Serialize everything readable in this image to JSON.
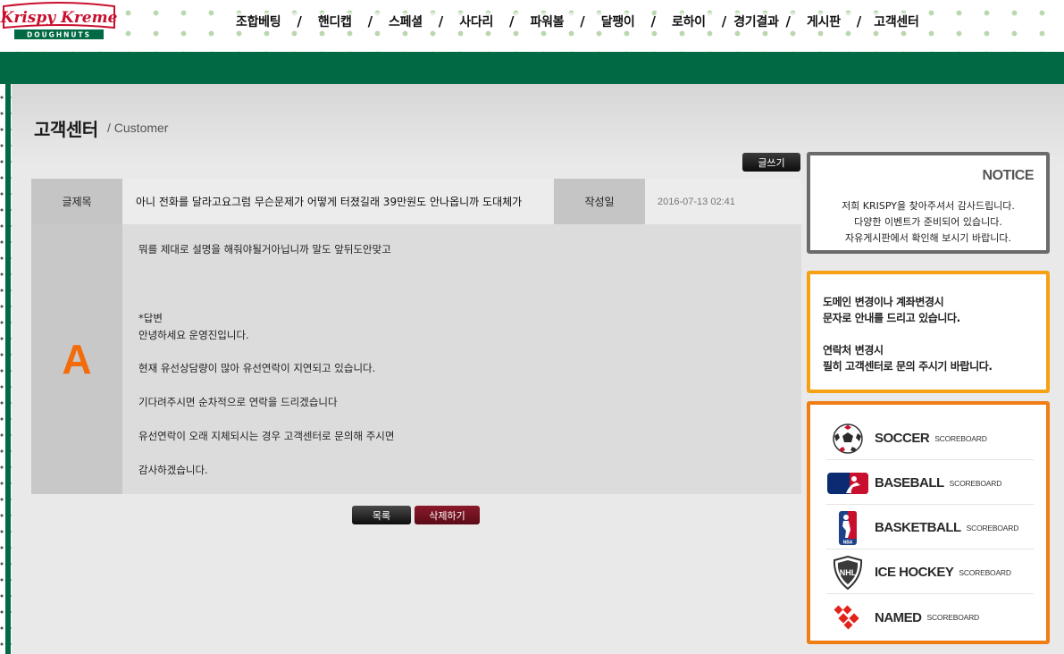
{
  "header": {
    "logo_text": "Krispy Kreme",
    "logo_sub": "DOUGHNUTS",
    "nav": [
      "조합베팅",
      "핸디캡",
      "스페셜",
      "사다리",
      "파워볼",
      "달팽이",
      "로하이",
      "경기결과",
      "게시판",
      "고객센터"
    ],
    "nav_separator": "/"
  },
  "page": {
    "title": "고객센터",
    "subtitle": "/ Customer"
  },
  "toolbar": {
    "write_label": "글쓰기"
  },
  "post": {
    "title_label": "글제목",
    "title": "아니 전화를 달라고요그럼 무슨문제가 어떻게 터졌길래 39만원도 안나옵니까 도대체가",
    "date_label": "작성일",
    "date": "2016-07-13 02:41",
    "answer_mark": "A",
    "body_lines": [
      "뭐를 제대로 설명을 해줘야될거아닙니까 말도 앞뒤도안맞고",
      "*답변",
      "안녕하세요 운영진입니다.",
      "현재 유선상담량이 많아 유선연락이 지연되고 있습니다.",
      "기다려주시면 순차적으로 연락을 드리겠습니다",
      "유선연락이 오래 지체되시는 경우 고객센터로 문의해 주시면",
      "감사하겠습니다."
    ]
  },
  "actions": {
    "list_label": "목록",
    "delete_label": "삭제하기"
  },
  "notice": {
    "title": "NOTICE",
    "lines": [
      "저희 KRISPY을 찾아주셔서 감사드립니다.",
      "다양한 이벤트가 준비되어 있습니다.",
      "자유게시판에서 확인해 보시기 바랍니다."
    ]
  },
  "info": {
    "lines_a": [
      "도메인 변경이나 계좌변경시",
      "문자로 안내를 드리고 있습니다."
    ],
    "lines_b": [
      "연락처 변경시",
      "필히 고객센터로 문의 주시기 바랍니다."
    ]
  },
  "scoreboards": [
    {
      "name": "SOCCER",
      "tag": "SCOREBOARD",
      "icon": "soccer-ball-icon"
    },
    {
      "name": "BASEBALL",
      "tag": "SCOREBOARD",
      "icon": "mlb-logo-icon"
    },
    {
      "name": "BASKETBALL",
      "tag": "SCOREBOARD",
      "icon": "nba-logo-icon"
    },
    {
      "name": "ICE HOCKEY",
      "tag": "SCOREBOARD",
      "icon": "nhl-logo-icon"
    },
    {
      "name": "NAMED",
      "tag": "SCOREBOARD",
      "icon": "named-logo-icon"
    }
  ],
  "colors": {
    "brand_green": "#016a45",
    "accent_orange": "#f36c0b",
    "box_orange": "#f07e14",
    "box_gold": "#f5a112",
    "delete_red": "#7a1222"
  }
}
